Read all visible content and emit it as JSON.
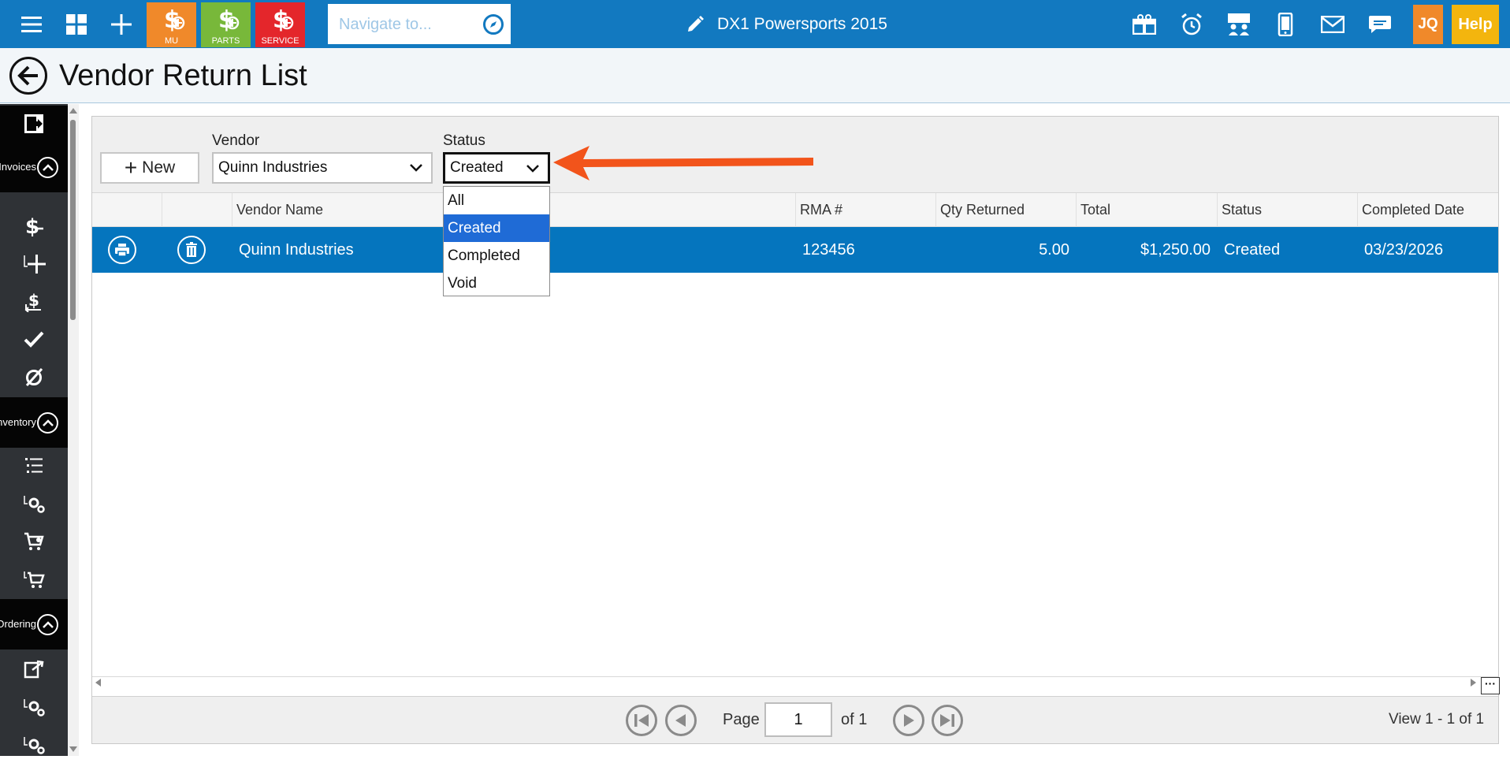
{
  "header": {
    "quick_actions": [
      {
        "label": "MU",
        "color": "#f0892a"
      },
      {
        "label": "PARTS",
        "color": "#78b83a"
      },
      {
        "label": "SERVICE",
        "color": "#e4262b"
      }
    ],
    "navigate_placeholder": "Navigate to...",
    "dealer_name": "DX1 Powersports 2015",
    "user_initials": "JQ",
    "help_label": "Help"
  },
  "page": {
    "title": "Vendor Return List"
  },
  "sidebar": {
    "sections": [
      {
        "label": "Invoices"
      },
      {
        "label": "Inventory"
      },
      {
        "label": "Ordering"
      }
    ]
  },
  "filters": {
    "new_label": "New",
    "vendor_label": "Vendor",
    "vendor_value": "Quinn Industries",
    "status_label": "Status",
    "status_value": "Created",
    "status_options": [
      "All",
      "Created",
      "Completed",
      "Void"
    ]
  },
  "grid": {
    "columns": [
      "Vendor Name",
      "RMA #",
      "Qty Returned",
      "Total",
      "Status",
      "Completed Date"
    ],
    "rows": [
      {
        "vendor": "Quinn Industries",
        "rma": "123456",
        "qty": "5.00",
        "total": "$1,250.00",
        "status": "Created",
        "completed": "03/23/2026"
      }
    ]
  },
  "pager": {
    "page_label": "Page",
    "page_value": "1",
    "of_label": "of 1",
    "view_count": "View 1 - 1 of 1"
  },
  "colors": {
    "topbar": "#1279c0",
    "row_selected": "#0575be",
    "dropdown_selected": "#1f6bd6",
    "annotation_arrow": "#f2541b"
  }
}
